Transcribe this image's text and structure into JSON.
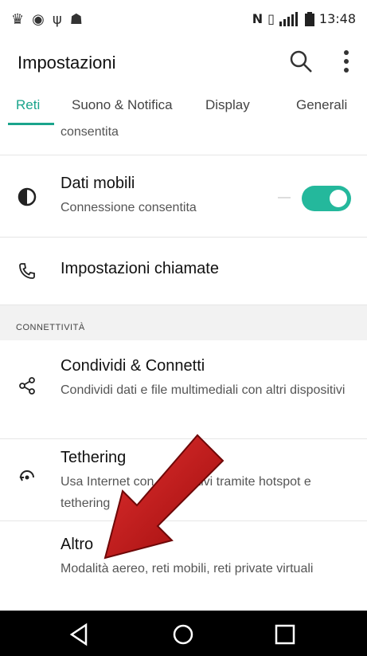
{
  "status_bar": {
    "left_icons": [
      "notification-icon-1",
      "notification-icon-2",
      "usb-icon",
      "android-icon"
    ],
    "right_icons": [
      "nfc-icon",
      "vibrate-icon",
      "signal-icon",
      "battery-icon"
    ],
    "time": "13:48"
  },
  "appbar": {
    "title": "Impostazioni",
    "icons": [
      "search-icon",
      "more-vert-icon"
    ]
  },
  "tabs": [
    {
      "label": "Reti",
      "active": true
    },
    {
      "label": "Suono & Notifica",
      "active": false
    },
    {
      "label": "Display",
      "active": false
    },
    {
      "label": "Generali",
      "active": false
    }
  ],
  "list": {
    "partial_top_text": "consentita",
    "dati_mobili": {
      "title": "Dati mobili",
      "subtitle": "Connessione consentita",
      "toggle_on": true
    },
    "impostazioni_chiamate": {
      "title": "Impostazioni chiamate"
    },
    "section_header": "CONNETTIVITÀ",
    "condividi": {
      "title": "Condividi & Connetti",
      "subtitle": "Condividi dati e file multimediali con altri dispositivi"
    },
    "tethering": {
      "title": "Tethering",
      "subtitle": "Usa Internet con dispositivi tramite hotspot e tethering"
    },
    "altro": {
      "title": "Altro",
      "subtitle": "Modalità aereo, reti mobili, reti private virtuali"
    }
  },
  "colors": {
    "accent": "#1aa48c",
    "toggle": "#24b89c",
    "arrow": "#c41212"
  },
  "navbar": {
    "buttons": [
      "back-icon",
      "home-icon",
      "recents-icon"
    ]
  }
}
